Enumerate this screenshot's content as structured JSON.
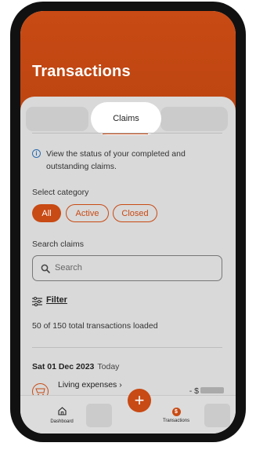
{
  "header": {
    "title": "Transactions"
  },
  "tabs": {
    "active_label": "Claims"
  },
  "info": {
    "text": "View the status of your completed and outstanding claims."
  },
  "category": {
    "label": "Select category",
    "options": [
      "All",
      "Active",
      "Closed"
    ],
    "selected": "All"
  },
  "search": {
    "label": "Search claims",
    "placeholder": "Search"
  },
  "filter": {
    "label": "Filter"
  },
  "status": {
    "loaded_text": "50 of 150 total transactions loaded"
  },
  "transactions": {
    "date": "Sat 01 Dec 2023",
    "date_tag": "Today",
    "items": [
      {
        "label": "Living expenses",
        "chevron": "›",
        "amount": "- $"
      }
    ]
  },
  "bottom_nav": {
    "dashboard_label": "Dashboard",
    "transactions_label": "Transactions",
    "fab_label": "+",
    "transactions_icon_glyph": "$"
  },
  "colors": {
    "accent": "#c84a14",
    "background": "#d9d9d9"
  }
}
